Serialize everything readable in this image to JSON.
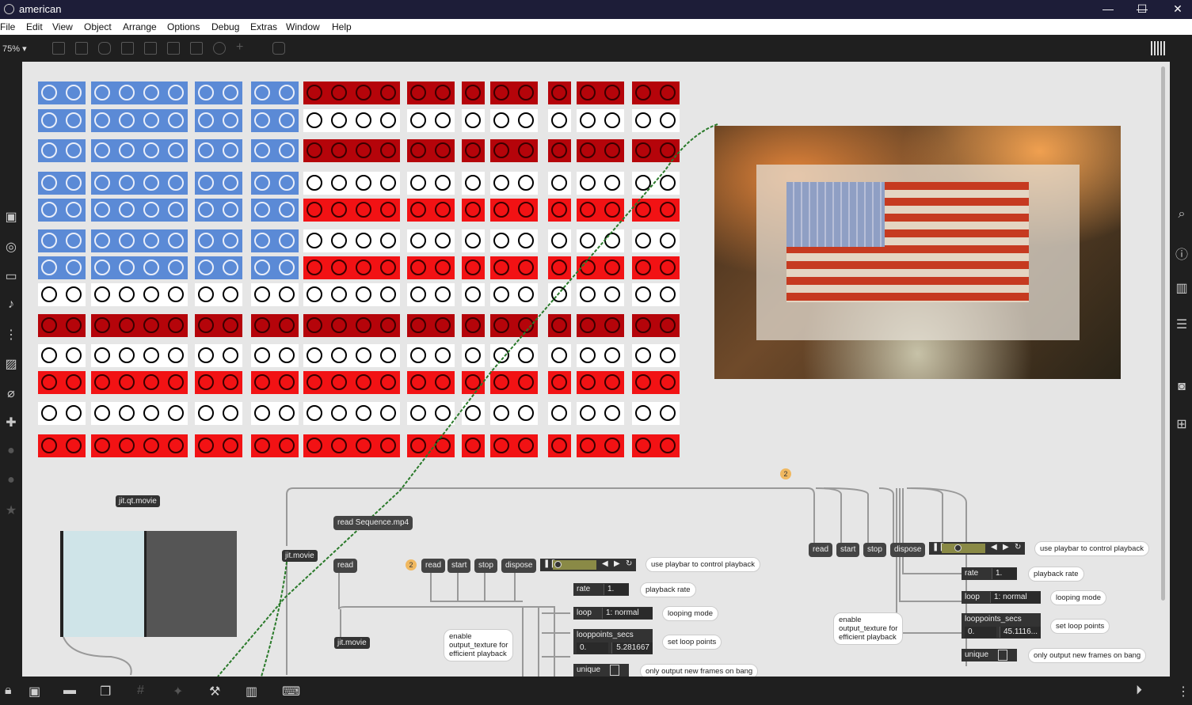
{
  "window": {
    "title": "american",
    "minimize": "—",
    "maximize": "☐",
    "close": "✕"
  },
  "menu": [
    "File",
    "Edit",
    "View",
    "Object",
    "Arrange",
    "Options",
    "Debug",
    "Extras",
    "Window",
    "Help"
  ],
  "toolbar": {
    "zoom": "75% ▾"
  },
  "flag": {
    "rows": [
      [
        "blue",
        "blue",
        "blue",
        "blue",
        "blue",
        "blue",
        "blue",
        "blue",
        "blue",
        "blue",
        "dark",
        "dark",
        "dark",
        "dark",
        "dark",
        "dark",
        "dark",
        "dark",
        "dark",
        "dark",
        "dark",
        "dark",
        "dark",
        "dark"
      ],
      [
        "blue",
        "blue",
        "blue",
        "blue",
        "blue",
        "blue",
        "blue",
        "blue",
        "blue",
        "blue",
        "white",
        "white",
        "white",
        "white",
        "white",
        "white",
        "white",
        "white",
        "white",
        "white",
        "white",
        "white",
        "white",
        "white"
      ],
      [
        "blue",
        "blue",
        "blue",
        "blue",
        "blue",
        "blue",
        "blue",
        "blue",
        "blue",
        "blue",
        "dark",
        "dark",
        "dark",
        "dark",
        "dark",
        "dark",
        "dark",
        "dark",
        "dark",
        "dark",
        "dark",
        "dark",
        "dark",
        "dark"
      ],
      [
        "blue",
        "blue",
        "blue",
        "blue",
        "blue",
        "blue",
        "blue",
        "blue",
        "blue",
        "blue",
        "white",
        "white",
        "white",
        "white",
        "white",
        "white",
        "white",
        "white",
        "white",
        "white",
        "white",
        "white",
        "white",
        "white"
      ],
      [
        "blue",
        "blue",
        "blue",
        "blue",
        "blue",
        "blue",
        "blue",
        "blue",
        "blue",
        "blue",
        "red",
        "red",
        "red",
        "red",
        "red",
        "red",
        "red",
        "red",
        "red",
        "red",
        "red",
        "red",
        "red",
        "red"
      ],
      [
        "blue",
        "blue",
        "blue",
        "blue",
        "blue",
        "blue",
        "blue",
        "blue",
        "blue",
        "blue",
        "white",
        "white",
        "white",
        "white",
        "white",
        "white",
        "white",
        "white",
        "white",
        "white",
        "white",
        "white",
        "white",
        "white"
      ],
      [
        "blue",
        "blue",
        "blue",
        "blue",
        "blue",
        "blue",
        "blue",
        "blue",
        "blue",
        "blue",
        "red",
        "red",
        "red",
        "red",
        "red",
        "red",
        "red",
        "red",
        "red",
        "red",
        "red",
        "red",
        "red",
        "red"
      ],
      [
        "white",
        "white",
        "white",
        "white",
        "white",
        "white",
        "white",
        "white",
        "white",
        "white",
        "white",
        "white",
        "white",
        "white",
        "white",
        "white",
        "white",
        "white",
        "white",
        "white",
        "white",
        "white",
        "white",
        "white"
      ],
      [
        "dark",
        "dark",
        "dark",
        "dark",
        "dark",
        "dark",
        "dark",
        "dark",
        "dark",
        "dark",
        "dark",
        "dark",
        "dark",
        "dark",
        "dark",
        "dark",
        "dark",
        "dark",
        "dark",
        "dark",
        "dark",
        "dark",
        "dark",
        "dark"
      ],
      [
        "white",
        "white",
        "white",
        "white",
        "white",
        "white",
        "white",
        "white",
        "white",
        "white",
        "white",
        "white",
        "white",
        "white",
        "white",
        "white",
        "white",
        "white",
        "white",
        "white",
        "white",
        "white",
        "white",
        "white"
      ],
      [
        "red",
        "red",
        "red",
        "red",
        "red",
        "red",
        "red",
        "red",
        "red",
        "red",
        "red",
        "red",
        "red",
        "red",
        "red",
        "red",
        "red",
        "red",
        "red",
        "red",
        "red",
        "red",
        "red",
        "red"
      ],
      [
        "white",
        "white",
        "white",
        "white",
        "white",
        "white",
        "white",
        "white",
        "white",
        "white",
        "white",
        "white",
        "white",
        "white",
        "white",
        "white",
        "white",
        "white",
        "white",
        "white",
        "white",
        "white",
        "white",
        "white"
      ],
      [
        "red",
        "red",
        "red",
        "red",
        "red",
        "red",
        "red",
        "red",
        "red",
        "red",
        "red",
        "red",
        "red",
        "red",
        "red",
        "red",
        "red",
        "red",
        "red",
        "red",
        "red",
        "red",
        "red",
        "red"
      ]
    ]
  },
  "patch_left": {
    "qt_movie": "jit.qt.movie",
    "read_sequence": "read Sequence.mp4",
    "jit_movie_top": "jit.movie",
    "read": "read",
    "badge": "2",
    "read2": "read",
    "start": "start",
    "stop": "stop",
    "dispose": "dispose",
    "playbar_comment": "use playbar to control playback",
    "rate_label": "rate",
    "rate_value": "1.",
    "rate_comment": "playback rate",
    "loop_label": "loop",
    "loop_value": "1: normal",
    "loop_comment": "looping mode",
    "looppoints_label": "looppoints_secs",
    "looppoints_start": "0.",
    "looppoints_end": "5.281667",
    "looppoints_comment": "set loop points",
    "unique_label": "unique",
    "unique_comment": "only output new frames on bang",
    "jit_movie_bottom": "jit.movie",
    "output_texture_comment": "enable\noutput_texture for\nefficient playback"
  },
  "patch_right": {
    "badge": "2",
    "read": "read",
    "start": "start",
    "stop": "stop",
    "dispose": "dispose",
    "playbar_comment": "use playbar to control playback",
    "rate_label": "rate",
    "rate_value": "1.",
    "rate_comment": "playback rate",
    "loop_label": "loop",
    "loop_value": "1: normal",
    "loop_comment": "looping mode",
    "looppoints_label": "looppoints_secs",
    "looppoints_start": "0.",
    "looppoints_end": "45.1116...",
    "looppoints_comment": "set loop points",
    "unique_label": "unique",
    "unique_comment": "only output new frames on bang",
    "output_texture_comment": "enable\noutput_texture for\nefficient playback"
  },
  "colors": {
    "blue": "#5b8ad6",
    "dark": "#b5040a",
    "red": "#f21214",
    "white": "#ffffff",
    "patch_bg": "#e6e6e6",
    "chrome": "#1f1f1f"
  }
}
